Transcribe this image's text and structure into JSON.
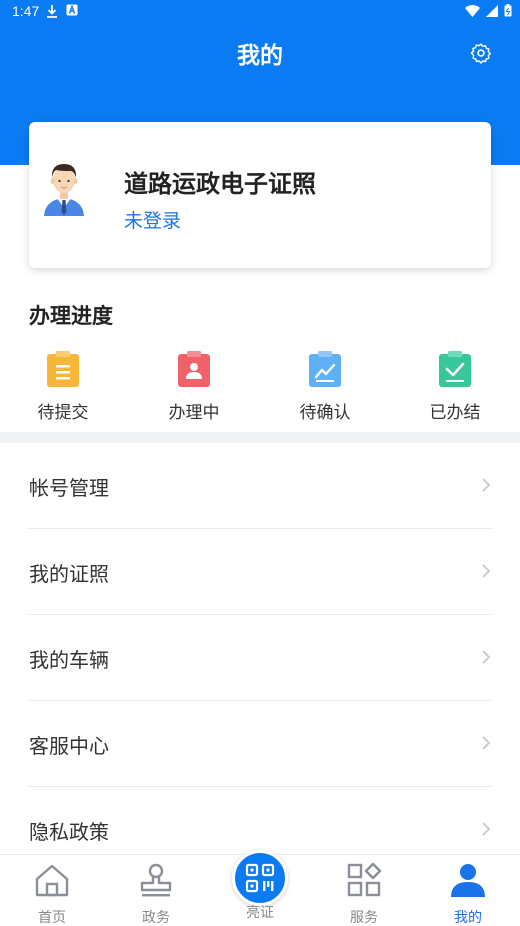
{
  "status_bar": {
    "time": "1:47"
  },
  "header": {
    "title": "我的"
  },
  "card": {
    "title": "道路运政电子证照",
    "login_status": "未登录"
  },
  "progress": {
    "title": "办理进度",
    "items": [
      {
        "label": "待提交",
        "color": "#f6b637"
      },
      {
        "label": "办理中",
        "color": "#f0626a"
      },
      {
        "label": "待确认",
        "color": "#5fb0f5"
      },
      {
        "label": "已办结",
        "color": "#37c79a"
      }
    ]
  },
  "menu": [
    {
      "label": "帐号管理"
    },
    {
      "label": "我的证照"
    },
    {
      "label": "我的车辆"
    },
    {
      "label": "客服中心"
    },
    {
      "label": "隐私政策"
    }
  ],
  "tabbar": {
    "tabs": [
      {
        "label": "首页",
        "icon": "home-icon"
      },
      {
        "label": "政务",
        "icon": "stamp-icon"
      },
      {
        "label": "亮证",
        "icon": "qr-code-icon"
      },
      {
        "label": "服务",
        "icon": "grid-icon"
      },
      {
        "label": "我的",
        "icon": "user-icon"
      }
    ],
    "active_color": "#1a73e8"
  },
  "colors": {
    "primary": "#0a7bf3"
  }
}
